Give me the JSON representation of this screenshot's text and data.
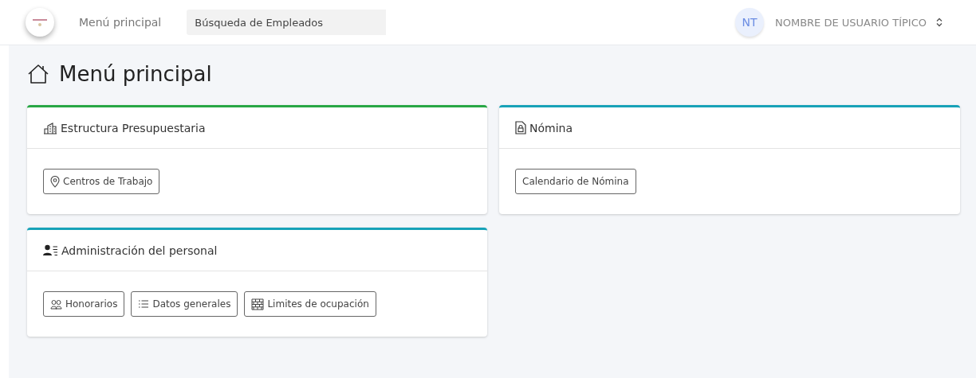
{
  "header": {
    "nav_link": "Menú principal",
    "search": {
      "value": "Búsqueda de Empleados"
    },
    "user": {
      "initials": "NT",
      "name": "NOMBRE DE USUARIO TÍPICO"
    }
  },
  "page_title": "Menú principal",
  "cards": [
    {
      "title": "Estructura Presupuestaria",
      "kind": "budget",
      "color": "#28a745",
      "buttons": [
        {
          "label": "Centros de Trabajo",
          "kind": "location"
        }
      ]
    },
    {
      "title": "Nómina",
      "kind": "payroll",
      "color": "#17a2b8",
      "buttons": [
        {
          "label": "Calendario de Nómina",
          "kind": "plain"
        }
      ]
    },
    {
      "title": "Administración del personal",
      "kind": "staff",
      "color": "#17a2b8",
      "buttons": [
        {
          "label": "Honorarios",
          "kind": "fees"
        },
        {
          "label": "Datos generales",
          "kind": "general"
        },
        {
          "label": "Limites de ocupación",
          "kind": "limits"
        }
      ]
    }
  ]
}
